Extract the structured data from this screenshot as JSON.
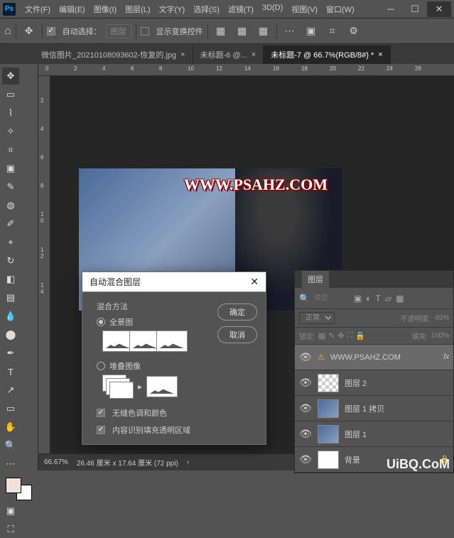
{
  "menu": {
    "file": "文件(F)",
    "edit": "编辑(E)",
    "image": "图像(I)",
    "layer": "图层(L)",
    "type": "文字(Y)",
    "select": "选择(S)",
    "filter": "滤镜(T)",
    "3d": "3D(D)",
    "view": "视图(V)",
    "window": "窗口(W)"
  },
  "optbar": {
    "auto_select": "自动选择：",
    "layer_combo": "图层",
    "show_transform": "显示变换控件"
  },
  "tabs": {
    "t1": "微信图片_20210108093602-恢复的.jpg",
    "t2": "未标题-6 @...",
    "t3": "未标题-7 @ 66.7%(RGB/8#) *"
  },
  "ruler_h": [
    "0",
    "2",
    "4",
    "6",
    "8",
    "10",
    "12",
    "14",
    "16",
    "18",
    "20",
    "22",
    "24",
    "26"
  ],
  "ruler_v": [
    "2",
    "4",
    "6",
    "8",
    "10",
    "12",
    "14"
  ],
  "canvas": {
    "watermark": "WWW.PSAHZ.COM"
  },
  "status": {
    "zoom": "66.67%",
    "doc": "26.46 厘米 x 17.64 厘米 (72 ppi)"
  },
  "dialog": {
    "title": "自动混合图层",
    "method_label": "混合方法",
    "panorama": "全景图",
    "stack": "堆叠图像",
    "seamless": "无缝色调和颜色",
    "content_aware": "内容识别填充透明区域",
    "ok": "确定",
    "cancel": "取消"
  },
  "layers": {
    "panel_title": "图层",
    "filter_placeholder": "类型",
    "blend_mode": "正常",
    "opacity_label": "不透明度:",
    "opacity_val": "49%",
    "lock_label": "锁定:",
    "fill_label": "填充:",
    "fill_val": "100%",
    "items": [
      {
        "name": "WWW.PSAHZ.COM"
      },
      {
        "name": "图层 2"
      },
      {
        "name": "图层 1 拷贝"
      },
      {
        "name": "图层 1"
      },
      {
        "name": "背景"
      }
    ]
  },
  "corner_wm": "UiBQ.CoM"
}
